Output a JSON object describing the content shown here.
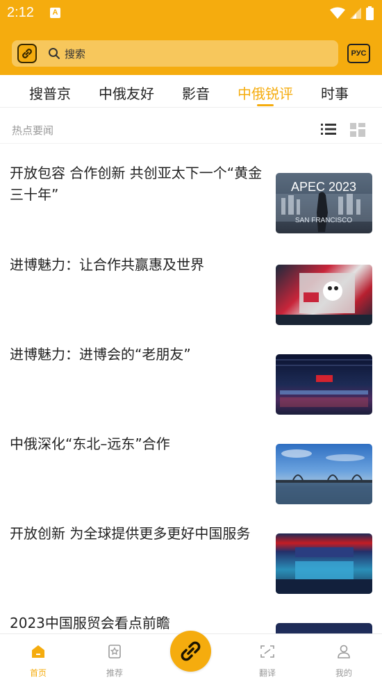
{
  "status_bar": {
    "time": "2:12",
    "notification_letter": "A"
  },
  "search": {
    "placeholder": "搜索",
    "lang_button": "РУС"
  },
  "tabs": [
    {
      "label": "搜普京"
    },
    {
      "label": "中俄友好"
    },
    {
      "label": "影音"
    },
    {
      "label": "中俄锐评",
      "active": true
    },
    {
      "label": "时事"
    }
  ],
  "section": {
    "title": "热点要闻"
  },
  "news": [
    {
      "title": "开放包容 合作创新 共创亚太下一个“黄金三十年”",
      "thumb_text_1": "APEC 2023",
      "thumb_text_2": "SAN FRANCISCO"
    },
    {
      "title": "进博魅力：让合作共赢惠及世界"
    },
    {
      "title": "进博魅力：进博会的“老朋友”"
    },
    {
      "title": "中俄深化“东北–远东”合作"
    },
    {
      "title": "开放创新 为全球提供更多更好中国服务"
    },
    {
      "title": "2023中国服贸会看点前瞻"
    }
  ],
  "bottom_nav": [
    {
      "label": "首页",
      "active": true
    },
    {
      "label": "推荐"
    },
    {
      "label": "翻译"
    },
    {
      "label": "我的"
    }
  ],
  "colors": {
    "accent": "#f5ac0e",
    "muted": "#999999"
  }
}
